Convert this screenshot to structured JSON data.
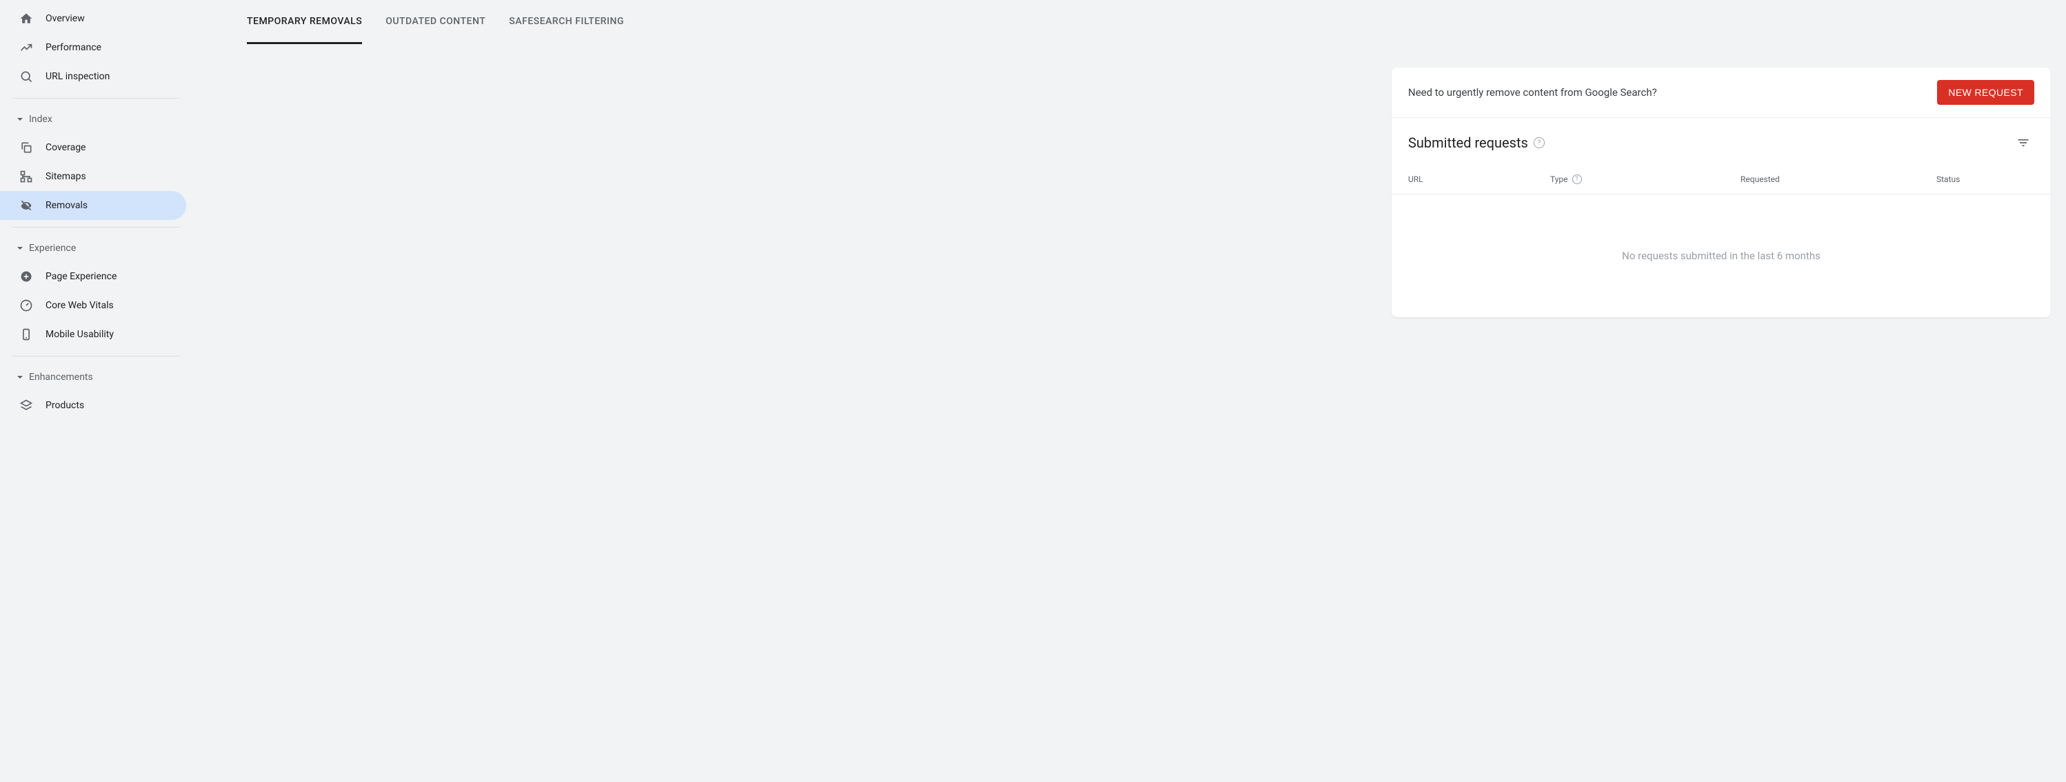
{
  "sidebar": {
    "items_top": [
      {
        "label": "Overview"
      },
      {
        "label": "Performance"
      },
      {
        "label": "URL inspection"
      }
    ],
    "section_index": {
      "title": "Index",
      "items": [
        {
          "label": "Coverage"
        },
        {
          "label": "Sitemaps"
        },
        {
          "label": "Removals",
          "active": true
        }
      ]
    },
    "section_experience": {
      "title": "Experience",
      "items": [
        {
          "label": "Page Experience"
        },
        {
          "label": "Core Web Vitals"
        },
        {
          "label": "Mobile Usability"
        }
      ]
    },
    "section_enhancements": {
      "title": "Enhancements",
      "items": [
        {
          "label": "Products"
        }
      ]
    }
  },
  "tabs": [
    {
      "label": "TEMPORARY REMOVALS",
      "active": true
    },
    {
      "label": "OUTDATED CONTENT"
    },
    {
      "label": "SAFESEARCH FILTERING"
    }
  ],
  "card": {
    "prompt": "Need to urgently remove content from Google Search?",
    "button": "NEW REQUEST",
    "subtitle": "Submitted requests",
    "columns": {
      "url": "URL",
      "type": "Type",
      "requested": "Requested",
      "status": "Status"
    },
    "empty": "No requests submitted in the last 6 months"
  }
}
